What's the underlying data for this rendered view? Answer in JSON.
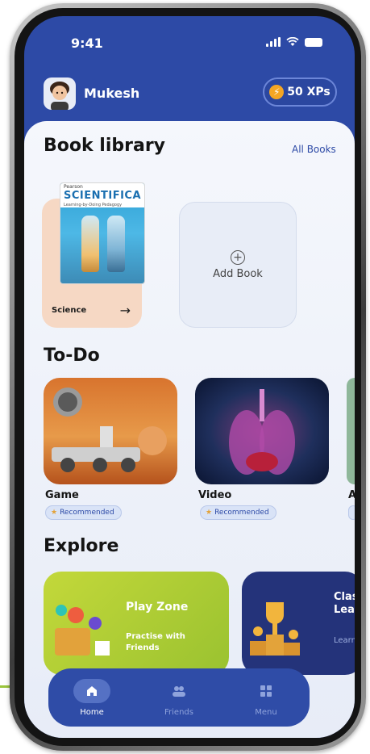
{
  "status_bar": {
    "time": "9:41"
  },
  "profile": {
    "name": "Mukesh",
    "xp_label": "50 XPs"
  },
  "book_library": {
    "title": "Book library",
    "all_books_link": "All Books",
    "books": [
      {
        "cover_brand": "Pearson",
        "cover_title": "SCIENTIFICA",
        "cover_subtitle": "Learning-by-Doing Pedagogy",
        "label": "Science"
      }
    ],
    "add_book_label": "Add Book"
  },
  "todo": {
    "title": "To-Do",
    "items": [
      {
        "label": "Game",
        "badge": "Recommended"
      },
      {
        "label": "Video",
        "badge": "Recommended"
      },
      {
        "label": "A"
      }
    ]
  },
  "explore": {
    "title": "Explore",
    "cards": [
      {
        "title": "Play Zone",
        "subtitle": "Practise with Friends"
      },
      {
        "title": "Clas Lea",
        "subtitle": "Learn"
      }
    ]
  },
  "nav": {
    "items": [
      {
        "label": "Home",
        "icon": "home-icon",
        "active": true
      },
      {
        "label": "Friends",
        "icon": "friends-icon",
        "active": false
      },
      {
        "label": "Menu",
        "icon": "menu-icon",
        "active": false
      }
    ]
  },
  "colors": {
    "primary": "#2d4aa6",
    "book_card": "#f6d8c4",
    "play_zone": "#b5cf2f",
    "classroom": "#24337a",
    "xp_bolt": "#f5a623",
    "accent": "#9bc53d"
  }
}
